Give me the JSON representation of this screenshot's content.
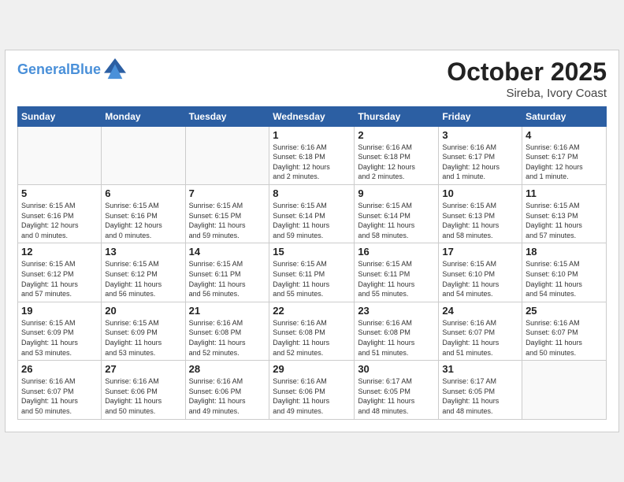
{
  "header": {
    "logo_line1": "General",
    "logo_line2": "Blue",
    "month": "October 2025",
    "location": "Sireba, Ivory Coast"
  },
  "weekdays": [
    "Sunday",
    "Monday",
    "Tuesday",
    "Wednesday",
    "Thursday",
    "Friday",
    "Saturday"
  ],
  "weeks": [
    [
      {
        "day": "",
        "info": ""
      },
      {
        "day": "",
        "info": ""
      },
      {
        "day": "",
        "info": ""
      },
      {
        "day": "1",
        "info": "Sunrise: 6:16 AM\nSunset: 6:18 PM\nDaylight: 12 hours\nand 2 minutes."
      },
      {
        "day": "2",
        "info": "Sunrise: 6:16 AM\nSunset: 6:18 PM\nDaylight: 12 hours\nand 2 minutes."
      },
      {
        "day": "3",
        "info": "Sunrise: 6:16 AM\nSunset: 6:17 PM\nDaylight: 12 hours\nand 1 minute."
      },
      {
        "day": "4",
        "info": "Sunrise: 6:16 AM\nSunset: 6:17 PM\nDaylight: 12 hours\nand 1 minute."
      }
    ],
    [
      {
        "day": "5",
        "info": "Sunrise: 6:15 AM\nSunset: 6:16 PM\nDaylight: 12 hours\nand 0 minutes."
      },
      {
        "day": "6",
        "info": "Sunrise: 6:15 AM\nSunset: 6:16 PM\nDaylight: 12 hours\nand 0 minutes."
      },
      {
        "day": "7",
        "info": "Sunrise: 6:15 AM\nSunset: 6:15 PM\nDaylight: 11 hours\nand 59 minutes."
      },
      {
        "day": "8",
        "info": "Sunrise: 6:15 AM\nSunset: 6:14 PM\nDaylight: 11 hours\nand 59 minutes."
      },
      {
        "day": "9",
        "info": "Sunrise: 6:15 AM\nSunset: 6:14 PM\nDaylight: 11 hours\nand 58 minutes."
      },
      {
        "day": "10",
        "info": "Sunrise: 6:15 AM\nSunset: 6:13 PM\nDaylight: 11 hours\nand 58 minutes."
      },
      {
        "day": "11",
        "info": "Sunrise: 6:15 AM\nSunset: 6:13 PM\nDaylight: 11 hours\nand 57 minutes."
      }
    ],
    [
      {
        "day": "12",
        "info": "Sunrise: 6:15 AM\nSunset: 6:12 PM\nDaylight: 11 hours\nand 57 minutes."
      },
      {
        "day": "13",
        "info": "Sunrise: 6:15 AM\nSunset: 6:12 PM\nDaylight: 11 hours\nand 56 minutes."
      },
      {
        "day": "14",
        "info": "Sunrise: 6:15 AM\nSunset: 6:11 PM\nDaylight: 11 hours\nand 56 minutes."
      },
      {
        "day": "15",
        "info": "Sunrise: 6:15 AM\nSunset: 6:11 PM\nDaylight: 11 hours\nand 55 minutes."
      },
      {
        "day": "16",
        "info": "Sunrise: 6:15 AM\nSunset: 6:11 PM\nDaylight: 11 hours\nand 55 minutes."
      },
      {
        "day": "17",
        "info": "Sunrise: 6:15 AM\nSunset: 6:10 PM\nDaylight: 11 hours\nand 54 minutes."
      },
      {
        "day": "18",
        "info": "Sunrise: 6:15 AM\nSunset: 6:10 PM\nDaylight: 11 hours\nand 54 minutes."
      }
    ],
    [
      {
        "day": "19",
        "info": "Sunrise: 6:15 AM\nSunset: 6:09 PM\nDaylight: 11 hours\nand 53 minutes."
      },
      {
        "day": "20",
        "info": "Sunrise: 6:15 AM\nSunset: 6:09 PM\nDaylight: 11 hours\nand 53 minutes."
      },
      {
        "day": "21",
        "info": "Sunrise: 6:16 AM\nSunset: 6:08 PM\nDaylight: 11 hours\nand 52 minutes."
      },
      {
        "day": "22",
        "info": "Sunrise: 6:16 AM\nSunset: 6:08 PM\nDaylight: 11 hours\nand 52 minutes."
      },
      {
        "day": "23",
        "info": "Sunrise: 6:16 AM\nSunset: 6:08 PM\nDaylight: 11 hours\nand 51 minutes."
      },
      {
        "day": "24",
        "info": "Sunrise: 6:16 AM\nSunset: 6:07 PM\nDaylight: 11 hours\nand 51 minutes."
      },
      {
        "day": "25",
        "info": "Sunrise: 6:16 AM\nSunset: 6:07 PM\nDaylight: 11 hours\nand 50 minutes."
      }
    ],
    [
      {
        "day": "26",
        "info": "Sunrise: 6:16 AM\nSunset: 6:07 PM\nDaylight: 11 hours\nand 50 minutes."
      },
      {
        "day": "27",
        "info": "Sunrise: 6:16 AM\nSunset: 6:06 PM\nDaylight: 11 hours\nand 50 minutes."
      },
      {
        "day": "28",
        "info": "Sunrise: 6:16 AM\nSunset: 6:06 PM\nDaylight: 11 hours\nand 49 minutes."
      },
      {
        "day": "29",
        "info": "Sunrise: 6:16 AM\nSunset: 6:06 PM\nDaylight: 11 hours\nand 49 minutes."
      },
      {
        "day": "30",
        "info": "Sunrise: 6:17 AM\nSunset: 6:05 PM\nDaylight: 11 hours\nand 48 minutes."
      },
      {
        "day": "31",
        "info": "Sunrise: 6:17 AM\nSunset: 6:05 PM\nDaylight: 11 hours\nand 48 minutes."
      },
      {
        "day": "",
        "info": ""
      }
    ]
  ]
}
